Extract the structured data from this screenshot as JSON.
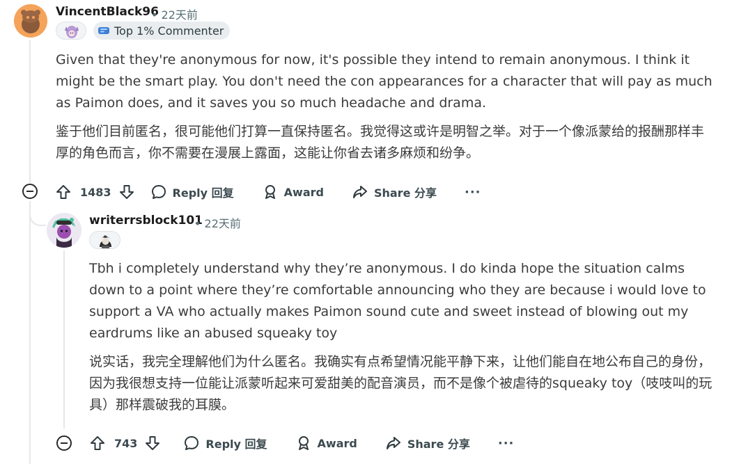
{
  "comments": [
    {
      "author": "VincentBlack96",
      "time": "• 22天前",
      "flair": "Top 1% Commenter",
      "body_en": "Given that they're anonymous for now, it's possible they intend to remain anonymous. I think it might be the smart play. You don't need the con appearances for a character that will pay as much as Paimon does, and it saves you so much headache and drama.",
      "body_zh": "鉴于他们目前匿名，很可能他们打算一直保持匿名。我觉得这或许是明智之举。对于一个像派蒙给的报酬那样丰厚的角色而言，你不需要在漫展上露面，这能让你省去诸多麻烦和纷争。",
      "votes": "1483",
      "reply_label": "Reply 回复",
      "award_label": "Award",
      "share_label": "Share 分享",
      "more_label": "···"
    },
    {
      "author": "writerrsblock101",
      "time": "• 22天前",
      "body_en": "Tbh i completely understand why they’re anonymous. I do kinda hope the situation calms down to a point where they’re comfortable announcing who they are because i would love to support a VA who actually makes Paimon sound cute and sweet instead of blowing out my eardrums like an abused squeaky toy",
      "body_zh": "说实话，我完全理解他们为什么匿名。我确实有点希望情况能平静下来，让他们能自在地公布自己的身份，因为我很想支持一位能让派蒙听起来可爱甜美的配音演员，而不是像个被虐待的squeaky toy（吱吱叫的玩具）那样震破我的耳膜。",
      "votes": "743",
      "reply_label": "Reply 回复",
      "award_label": "Award",
      "share_label": "Share 分享",
      "more_label": "···"
    }
  ],
  "colors": {
    "accent_orange": "#f08a24",
    "text": "#1a1a1b",
    "muted": "#576f76",
    "pill_bg": "#eaedef"
  }
}
